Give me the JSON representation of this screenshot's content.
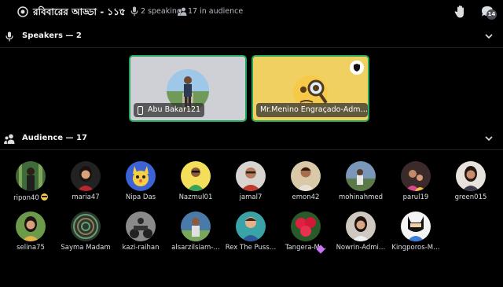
{
  "header": {
    "title": "রবিবারের আড্ডা - ১১৫",
    "separator": "•",
    "speaking": "2 speaking",
    "audience": "17 in audience",
    "chat_badge": "14",
    "icons": [
      "stage-channel-icon",
      "microphone-icon",
      "audience-icon",
      "raise-hand-icon",
      "chat-icon"
    ]
  },
  "speakers_section": {
    "title": "Speakers — 2",
    "speakers": [
      {
        "name": "Abu Bakar121",
        "device": "mobile",
        "speaking": true
      },
      {
        "name": "Mr.Menino Engraçado-Adm…",
        "moderator": true,
        "speaking": true
      }
    ]
  },
  "audience_section": {
    "title": "Audience — 17",
    "members": [
      {
        "name": "ripon40"
      },
      {
        "name": "maria47"
      },
      {
        "name": "Nipa Das"
      },
      {
        "name": "Nazmul01"
      },
      {
        "name": "jamal7"
      },
      {
        "name": "emon42"
      },
      {
        "name": "mohinahmed"
      },
      {
        "name": "parul19"
      },
      {
        "name": "green015"
      },
      {
        "name": "selina75"
      },
      {
        "name": "Sayma Madam"
      },
      {
        "name": "kazi-raihan"
      },
      {
        "name": "alsarzilsiam-…"
      },
      {
        "name": "Rex The Puss…"
      },
      {
        "name": "Tangera-M…"
      },
      {
        "name": "Nowrin-Admi…"
      },
      {
        "name": "Kingporos-M…"
      }
    ]
  },
  "colors": {
    "background": "#000000",
    "speaking_ring": "#23a55a",
    "text": "#dbdee1"
  }
}
